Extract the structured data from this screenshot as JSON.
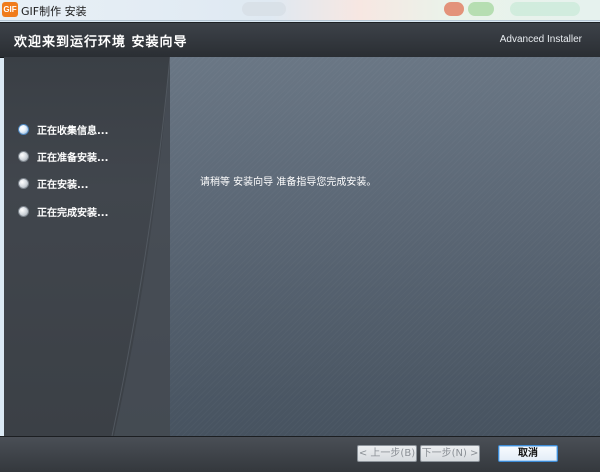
{
  "window": {
    "title": "GIF制作 安装",
    "app_icon_text": "GIF"
  },
  "header": {
    "title": "欢迎来到运行环境 安装向导",
    "brand": "Advanced Installer"
  },
  "steps": [
    {
      "label": "正在收集信息...",
      "active": true
    },
    {
      "label": "正在准备安装...",
      "active": false
    },
    {
      "label": "正在安装...",
      "active": false
    },
    {
      "label": "正在完成安装...",
      "active": false
    }
  ],
  "main": {
    "message": "请稍等 安装向导 准备指导您完成安装。"
  },
  "footer": {
    "back_label": "< 上一步(B)",
    "next_label": "下一步(N) >",
    "cancel_label": "取消"
  }
}
